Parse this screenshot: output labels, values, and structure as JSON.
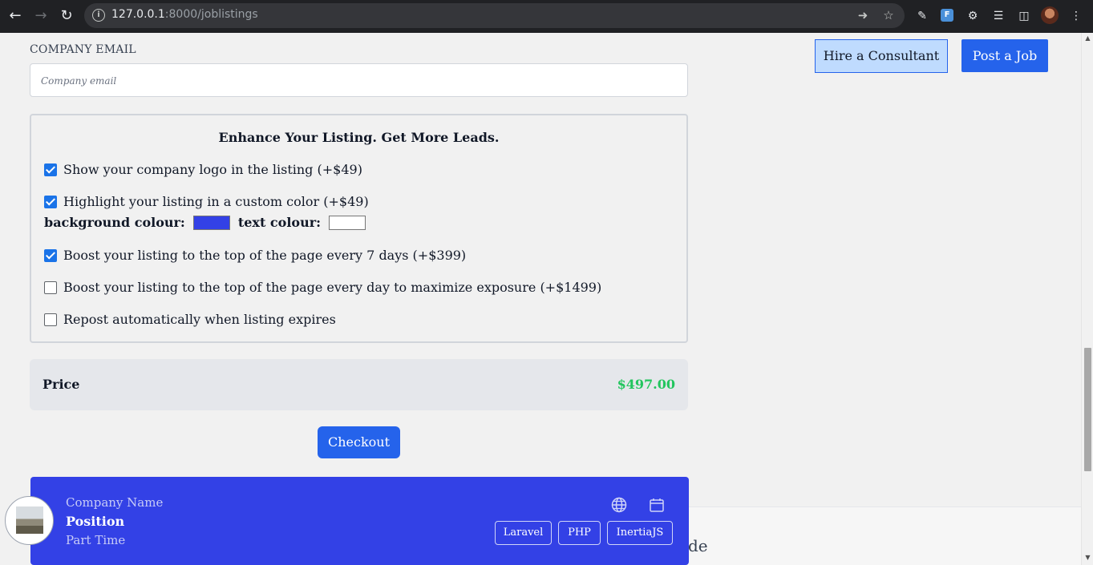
{
  "browser": {
    "url_host": "127.0.0.1",
    "url_path": ":8000/joblistings"
  },
  "header": {
    "consultant_label": "Hire a Consultant",
    "post_label": "Post a Job"
  },
  "email": {
    "label": "COMPANY EMAIL",
    "placeholder": "Company email"
  },
  "enhance": {
    "title": "Enhance Your Listing. Get More Leads.",
    "options": [
      {
        "label": "Show your company logo in the listing (+$49)",
        "checked": true
      },
      {
        "label": "Highlight your listing in a custom color (+$49)",
        "checked": true
      },
      {
        "label": "Boost your listing to the top of the page every 7 days (+$399)",
        "checked": true
      },
      {
        "label": "Boost your listing to the top of the page every day to maximize exposure (+$1499)",
        "checked": false
      },
      {
        "label": "Repost automatically when listing expires",
        "checked": false
      }
    ],
    "bg_colour_label": "background colour:",
    "text_colour_label": "text colour:",
    "bg_colour": "#3341e6",
    "text_colour": "#ffffff"
  },
  "price": {
    "label": "Price",
    "value": "$497.00"
  },
  "checkout_label": "Checkout",
  "preview": {
    "company": "Company Name",
    "position": "Position",
    "type": "Part Time",
    "tags": [
      "Laravel",
      "PHP",
      "InertiaJS"
    ]
  },
  "side_panel_text": "de"
}
